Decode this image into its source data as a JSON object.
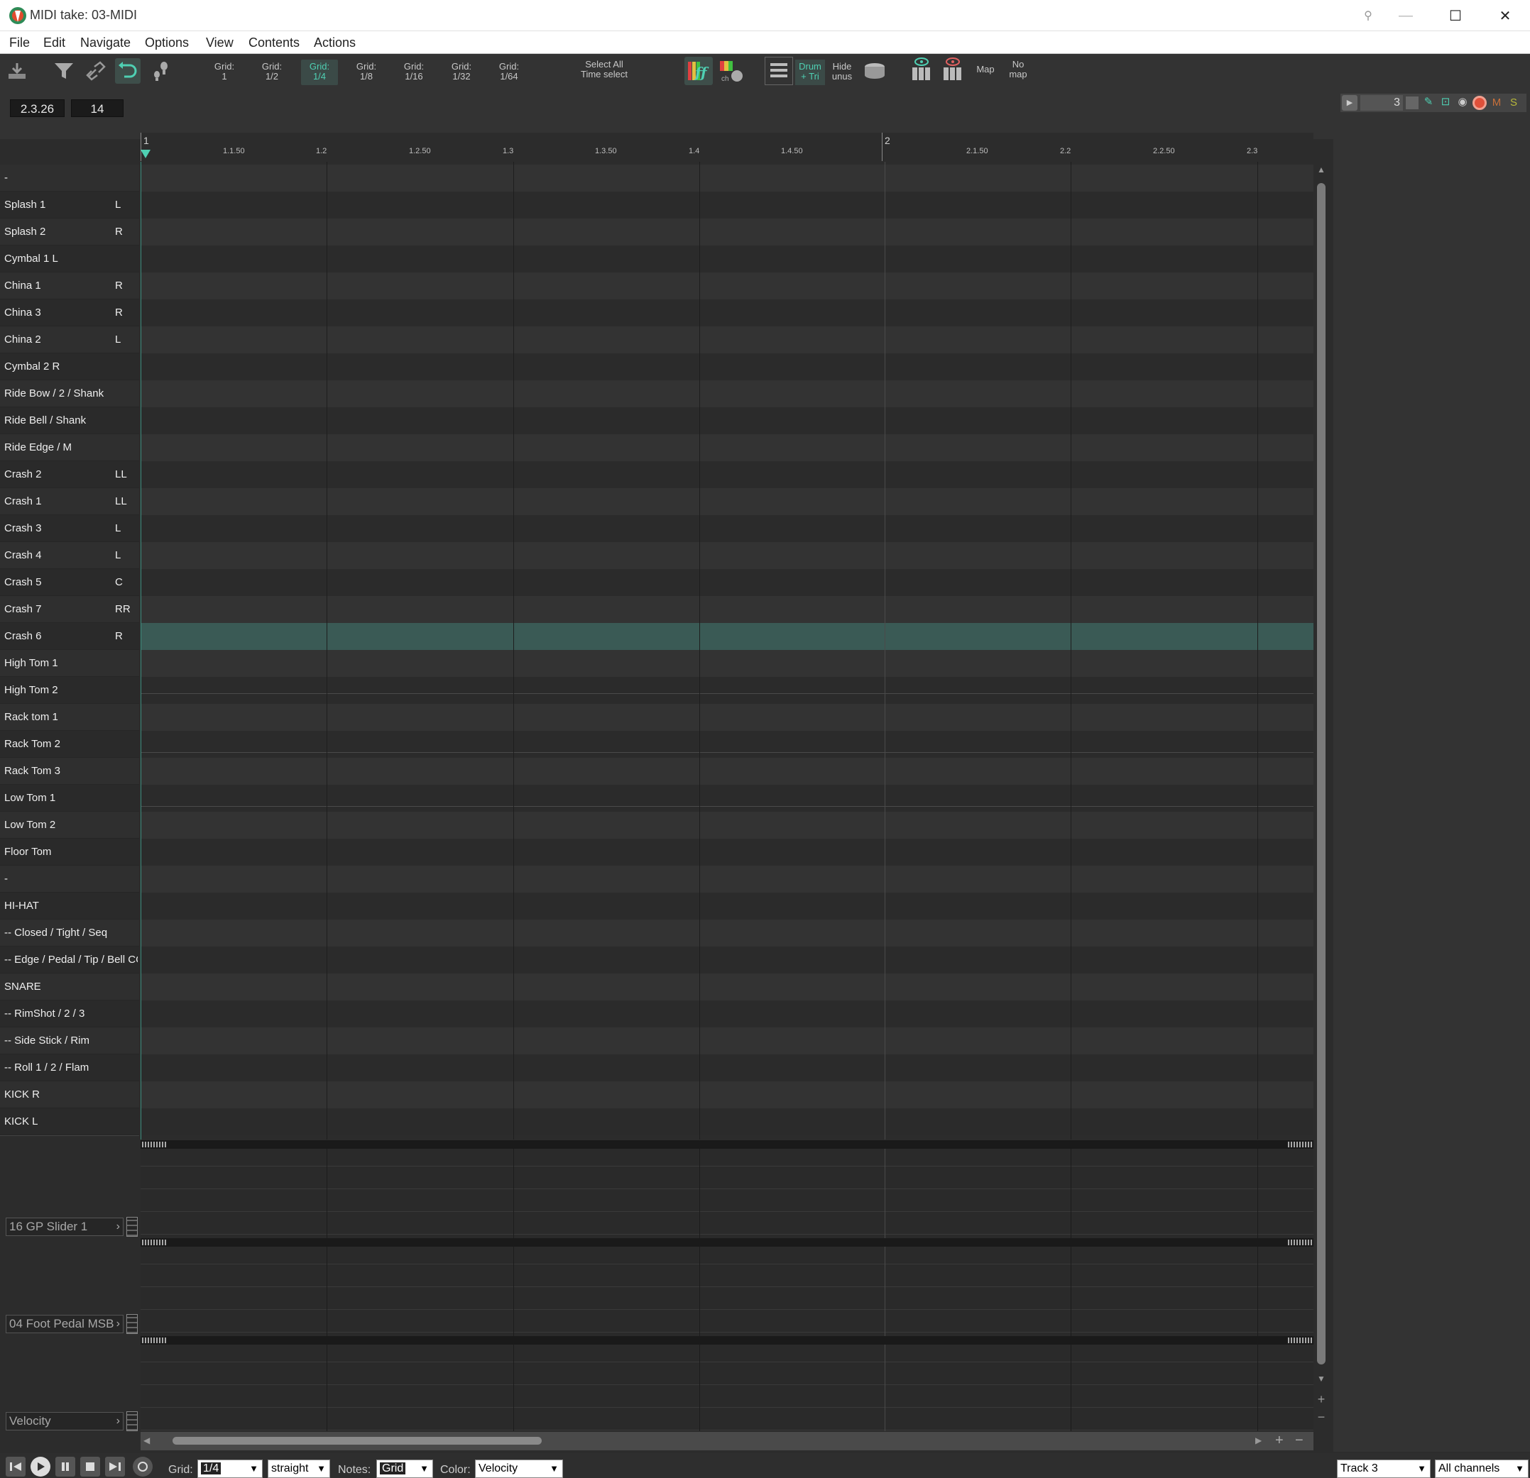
{
  "window": {
    "title": "MIDI take: 03-MIDI"
  },
  "menu": [
    "File",
    "Edit",
    "Navigate",
    "Options",
    "View",
    "Contents",
    "Actions"
  ],
  "toolbar": {
    "grid_buttons": [
      {
        "line1": "Grid:",
        "line2": "1"
      },
      {
        "line1": "Grid:",
        "line2": "1/2"
      },
      {
        "line1": "Grid:",
        "line2": "1/4"
      },
      {
        "line1": "Grid:",
        "line2": "1/8"
      },
      {
        "line1": "Grid:",
        "line2": "1/16"
      },
      {
        "line1": "Grid:",
        "line2": "1/32"
      },
      {
        "line1": "Grid:",
        "line2": "1/64"
      }
    ],
    "active_grid": "1/4",
    "select_all": {
      "line1": "Select All",
      "line2": "Time select"
    },
    "drum_tri": {
      "line1": "Drum",
      "line2": "+ Tri"
    },
    "hide_unus": {
      "line1": "Hide",
      "line2": "unus"
    },
    "map": "Map",
    "no_map": {
      "line1": "No",
      "line2": "map"
    },
    "position": "2.3.26",
    "value": "14"
  },
  "ruler": {
    "major": [
      "1",
      "2"
    ],
    "minor": [
      "1.1.50",
      "1.2",
      "1.2.50",
      "1.3",
      "1.3.50",
      "1.4",
      "1.4.50",
      "2.1.50",
      "2.2",
      "2.2.50",
      "2.3"
    ]
  },
  "keys": [
    {
      "name": "-",
      "mark": ""
    },
    {
      "name": "Splash 1",
      "mark": "L"
    },
    {
      "name": "Splash 2",
      "mark": "R"
    },
    {
      "name": "Cymbal 1 L",
      "mark": ""
    },
    {
      "name": "China 1",
      "mark": "R"
    },
    {
      "name": "China 3",
      "mark": "R"
    },
    {
      "name": "China 2",
      "mark": "L"
    },
    {
      "name": "Cymbal 2 R",
      "mark": ""
    },
    {
      "name": "Ride Bow / 2 / Shank",
      "mark": ""
    },
    {
      "name": "Ride Bell  / Shank",
      "mark": ""
    },
    {
      "name": "Ride Edge / M",
      "mark": ""
    },
    {
      "name": "Crash 2",
      "mark": "LL"
    },
    {
      "name": "Crash 1",
      "mark": "LL"
    },
    {
      "name": "Crash 3",
      "mark": "L"
    },
    {
      "name": "Crash 4",
      "mark": "L"
    },
    {
      "name": "Crash 5",
      "mark": "C"
    },
    {
      "name": "Crash 7",
      "mark": "RR"
    },
    {
      "name": "Crash 6",
      "mark": "R"
    },
    {
      "name": "High Tom 1",
      "mark": ""
    },
    {
      "name": "High Tom 2",
      "mark": ""
    },
    {
      "name": "Rack tom 1",
      "mark": ""
    },
    {
      "name": "Rack Tom 2",
      "mark": ""
    },
    {
      "name": "Rack Tom 3",
      "mark": ""
    },
    {
      "name": "Low Tom 1",
      "mark": ""
    },
    {
      "name": "Low Tom 2",
      "mark": ""
    },
    {
      "name": "Floor Tom",
      "mark": ""
    },
    {
      "name": "-",
      "mark": ""
    },
    {
      "name": "HI-HAT",
      "mark": ""
    },
    {
      "name": "-- Closed / Tight / Seq",
      "mark": ""
    },
    {
      "name": "-- Edge / Pedal / Tip / Bell CC",
      "mark": ""
    },
    {
      "name": "SNARE",
      "mark": ""
    },
    {
      "name": "-- RimShot / 2 / 3",
      "mark": ""
    },
    {
      "name": "-- Side Stick / Rim",
      "mark": ""
    },
    {
      "name": "-- Roll 1 / 2 / Flam",
      "mark": ""
    },
    {
      "name": "KICK R",
      "mark": ""
    },
    {
      "name": "KICK L",
      "mark": ""
    }
  ],
  "selected_key": "Crash 6",
  "cc_lanes": [
    "16 GP Slider 1",
    "04 Foot Pedal MSB",
    "Velocity"
  ],
  "bottom": {
    "grid_label": "Grid:",
    "grid_value": "1/4",
    "swing_value": "straight",
    "notes_label": "Notes:",
    "notes_value": "Grid",
    "color_label": "Color:",
    "color_value": "Velocity",
    "track_value": "Track 3",
    "channels_value": "All channels"
  },
  "track_panel": {
    "number": "3",
    "mute": "M",
    "solo": "S"
  },
  "colors": {
    "accent": "#4fd0b3",
    "selected_row": "#3a5a55",
    "record": "#e0503a",
    "mute": "#c8703a",
    "solo": "#b8b83a"
  }
}
